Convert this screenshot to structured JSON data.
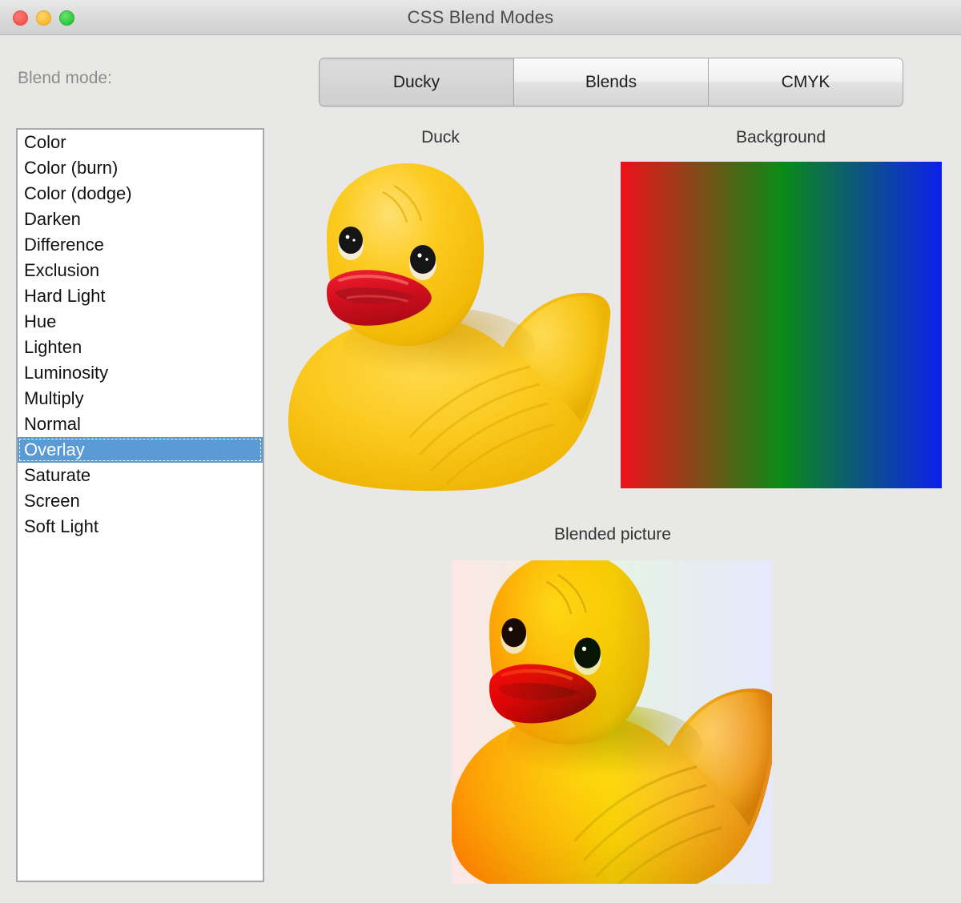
{
  "window": {
    "title": "CSS Blend Modes",
    "traffic_lights": [
      {
        "name": "close",
        "color": "#f6564f"
      },
      {
        "name": "minimize",
        "color": "#fcba2e"
      },
      {
        "name": "zoom",
        "color": "#2ac93f"
      }
    ],
    "background_color": "#e8e8e6"
  },
  "controls": {
    "blend_mode_label": "Blend mode:",
    "selected_blend_mode": "Overlay",
    "selection_color": "#5b9bd5",
    "blend_modes": [
      "Color",
      "Color (burn)",
      "Color (dodge)",
      "Darken",
      "Difference",
      "Exclusion",
      "Hard Light",
      "Hue",
      "Lighten",
      "Luminosity",
      "Multiply",
      "Normal",
      "Overlay",
      "Saturate",
      "Screen",
      "Soft Light"
    ]
  },
  "tabs": [
    {
      "label": "Ducky",
      "selected": true
    },
    {
      "label": "Blends",
      "selected": false
    },
    {
      "label": "CMYK",
      "selected": false
    }
  ],
  "panels": {
    "duck": {
      "caption": "Duck",
      "image_name": "rubber-duck",
      "body_color": "#f5c013",
      "beak_color": "#d40f1f",
      "eye_color": "#141414"
    },
    "background": {
      "caption": "Background",
      "image_name": "rgb-gradient",
      "gradient_stops": [
        "#ed1119",
        "#0b8a16",
        "#0d20eb"
      ],
      "gradient_direction": "to right"
    },
    "blended": {
      "caption": "Blended picture",
      "image_name": "duck-overlay-gradient",
      "blend_mode": "overlay"
    }
  }
}
